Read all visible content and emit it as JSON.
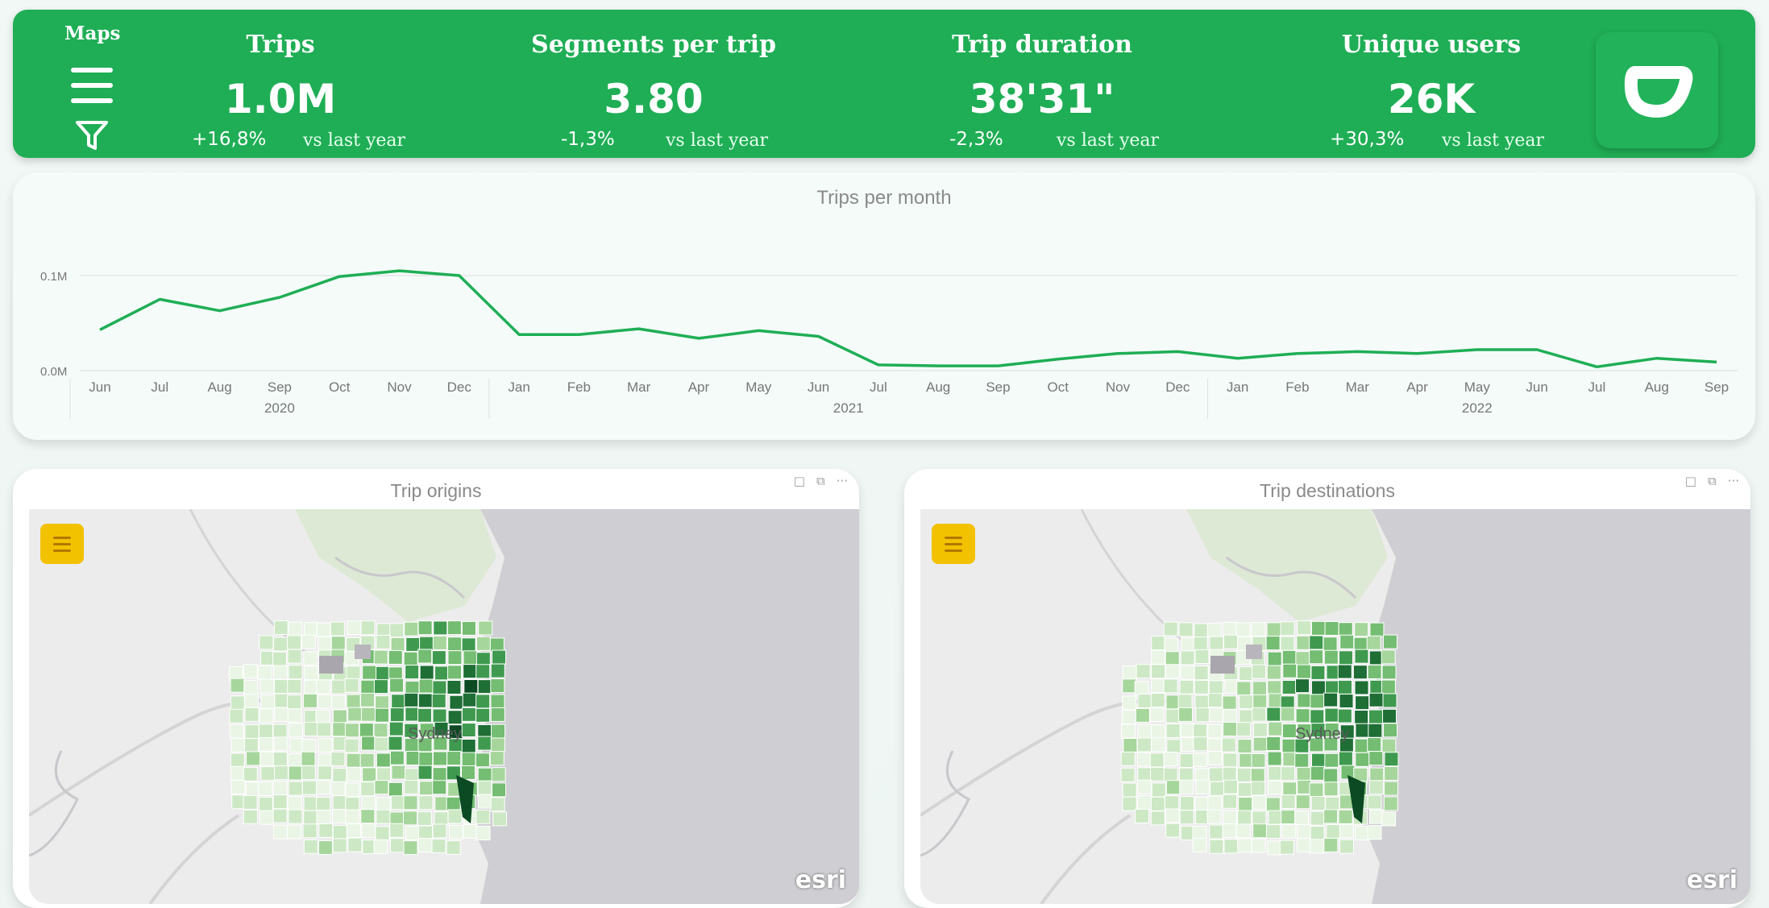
{
  "header": {
    "maps_label": "Maps",
    "kpis": [
      {
        "title": "Trips",
        "value": "1.0M",
        "change": "+16,8%",
        "vs": "vs last year"
      },
      {
        "title": "Segments per trip",
        "value": "3.80",
        "change": "-1,3%",
        "vs": "vs last year"
      },
      {
        "title": "Trip duration",
        "value": "38'31\"",
        "change": "-2,3%",
        "vs": "vs last year"
      },
      {
        "title": "Unique users",
        "value": "26K",
        "change": "+30,3%",
        "vs": "vs last year"
      }
    ],
    "accent": "#1fae55"
  },
  "chart_data": {
    "type": "line",
    "title": "Trips per month",
    "y_tick_labels": [
      "0.0M",
      "0.1M"
    ],
    "ylim": [
      0,
      0.1
    ],
    "x": [
      "Jun",
      "Jul",
      "Aug",
      "Sep",
      "Oct",
      "Nov",
      "Dec",
      "Jan",
      "Feb",
      "Mar",
      "Apr",
      "May",
      "Jun",
      "Jul",
      "Aug",
      "Sep",
      "Oct",
      "Nov",
      "Dec",
      "Jan",
      "Feb",
      "Mar",
      "Apr",
      "May",
      "Jun",
      "Jul",
      "Aug",
      "Sep"
    ],
    "years": [
      {
        "label": "2020",
        "span": [
          0,
          6
        ]
      },
      {
        "label": "2021",
        "span": [
          7,
          18
        ]
      },
      {
        "label": "2022",
        "span": [
          19,
          27
        ]
      }
    ],
    "series": [
      {
        "values": [
          0.043,
          0.075,
          0.063,
          0.077,
          0.099,
          0.105,
          0.1,
          0.038,
          0.038,
          0.044,
          0.034,
          0.042,
          0.036,
          0.006,
          0.005,
          0.005,
          0.012,
          0.018,
          0.02,
          0.013,
          0.018,
          0.02,
          0.018,
          0.022,
          0.022,
          0.004,
          0.013,
          0.009
        ],
        "color": "#1fae55"
      }
    ],
    "grid": true
  },
  "maps": [
    {
      "title": "Trip origins",
      "city": "Sydney",
      "attribution": "esri"
    },
    {
      "title": "Trip destinations",
      "city": "Sydney",
      "attribution": "esri"
    }
  ],
  "icons": [
    "hamburger-icon",
    "filter-icon",
    "logo-icon",
    "menu-icon",
    "focus-mode-icon",
    "copy-icon",
    "more-options-icon"
  ]
}
